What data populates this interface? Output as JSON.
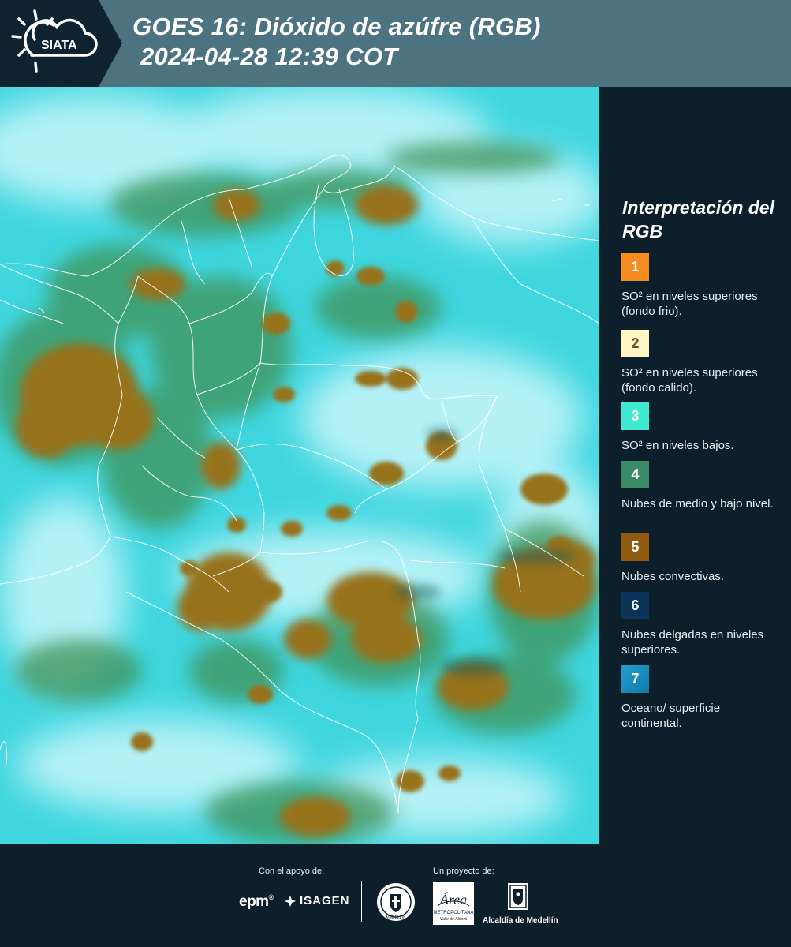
{
  "header": {
    "logo_text": "SIATA",
    "title_line1": "GOES 16: Dióxido de azúfre (RGB)",
    "title_line2": "2024-04-28 12:39 COT"
  },
  "map": {
    "background_color": "#3fd6df",
    "convective_cloud_color": "#96721e",
    "mid_low_cloud_color": "#3f9256",
    "border_color": "#ffffff"
  },
  "legend": {
    "title": "Interpretación del RGB",
    "items": [
      {
        "number": "1",
        "color": "#f68b1f",
        "text_color": "#ffffff",
        "label": "SO² en niveles superiores (fondo frio)."
      },
      {
        "number": "2",
        "color": "#fff6c4",
        "text_color": "#5a5a3a",
        "label": "SO² en niveles superiores (fondo calido)."
      },
      {
        "number": "3",
        "color": "#3fe8d0",
        "text_color": "#ffffff",
        "label": "SO² en niveles bajos."
      },
      {
        "number": "4",
        "color": "#3b8a66",
        "text_color": "#ffffff",
        "label": "Nubes de medio y bajo nivel."
      },
      {
        "number": "5",
        "color": "#8f5b10",
        "text_color": "#ffffff",
        "label": "Nubes convectivas."
      },
      {
        "number": "6",
        "color": "#0c3358",
        "text_color": "#ffffff",
        "label": "Nubes delgadas en niveles superiores."
      },
      {
        "number": "7",
        "color": "#1b8fc2",
        "text_color": "#ffffff",
        "label": "Oceano/ superficie continental."
      }
    ]
  },
  "footer": {
    "support_caption": "Con el apoyo de:",
    "project_caption": "Un proyecto de:",
    "epm_logo": "epm",
    "isagen_logo": "ISAGEN",
    "area_logo_text": "Área",
    "area_logo_subtext": "METROPOLITANA",
    "area_logo_subtext2": "Valle de Aburrá",
    "seal_text": "MEDELLÍN",
    "alcaldia_logo": "Alcaldía de Medellín"
  }
}
